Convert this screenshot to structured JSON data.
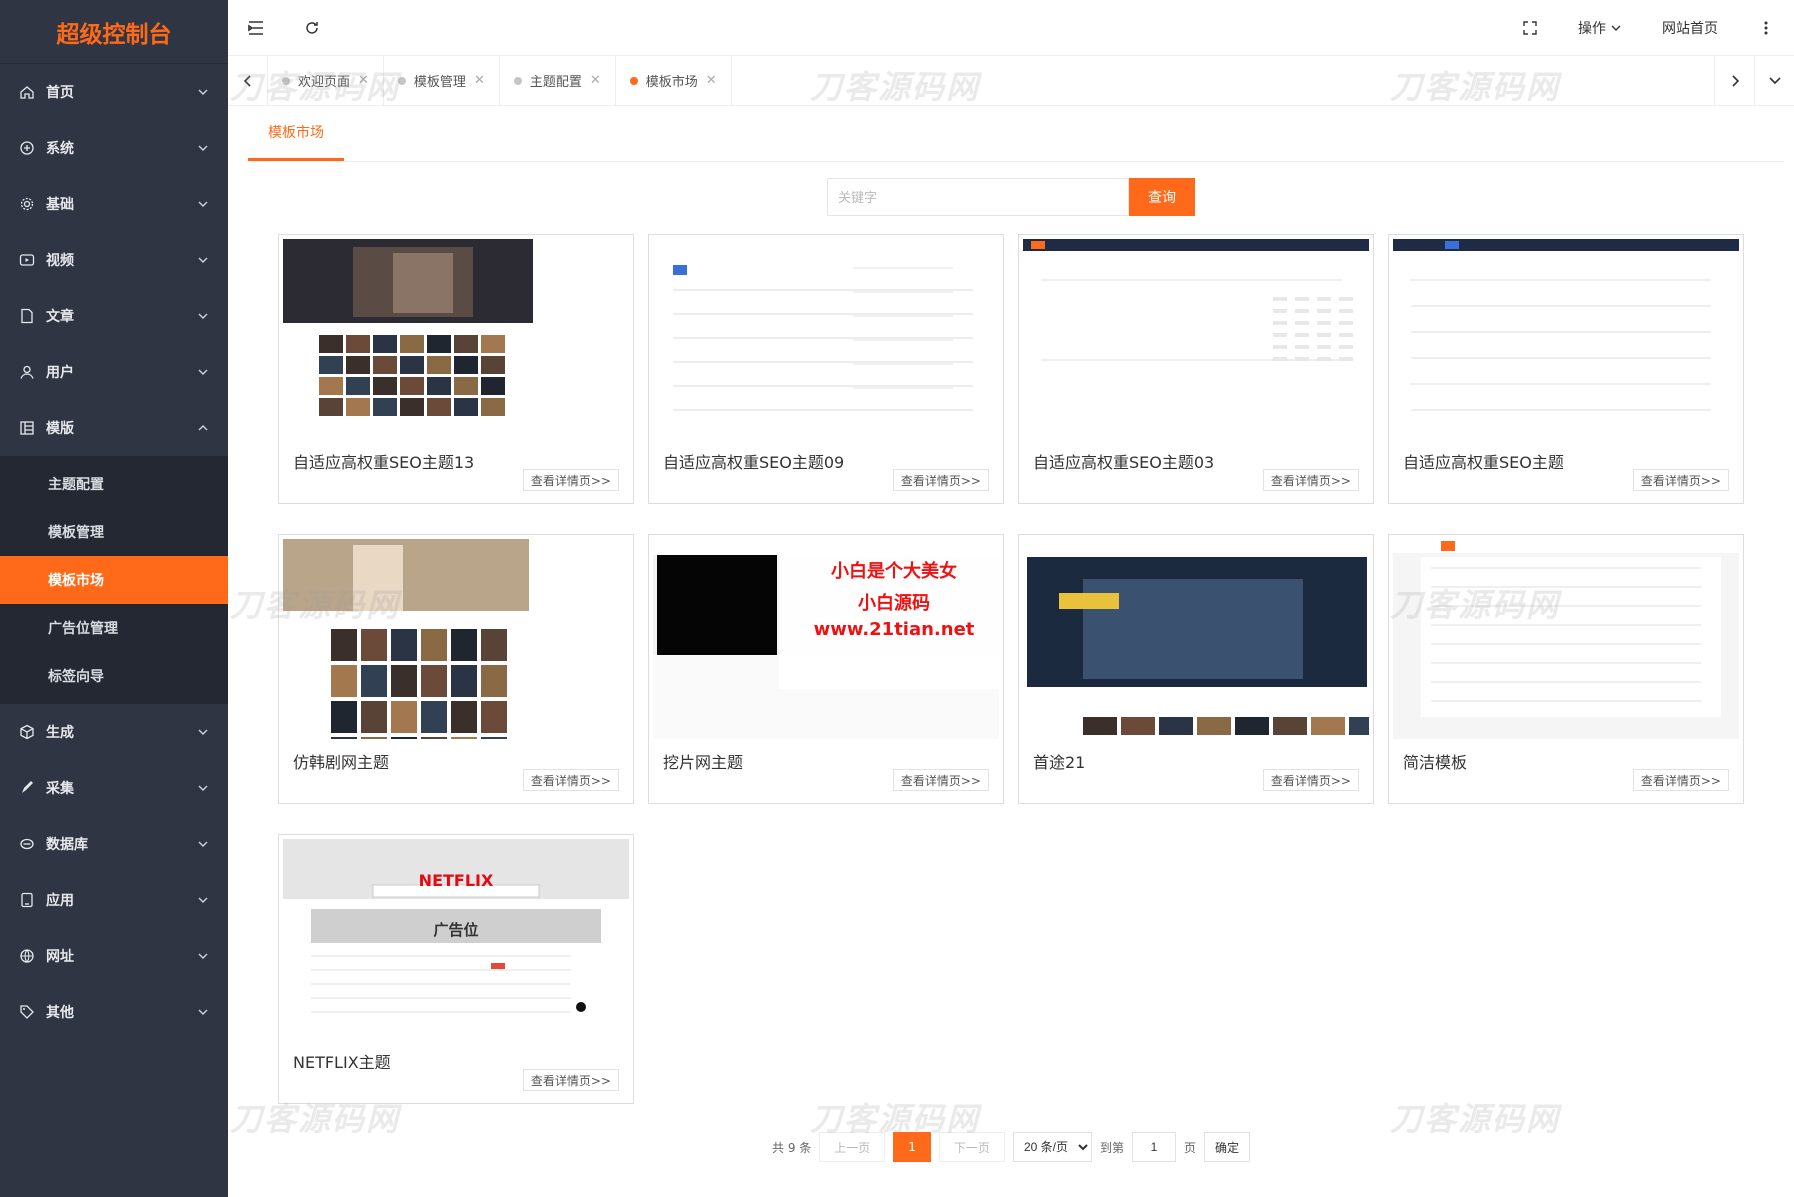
{
  "brand": "超级控制台",
  "sidebar": {
    "items": [
      {
        "label": "首页",
        "icon": "home-icon"
      },
      {
        "label": "系统",
        "icon": "system-icon"
      },
      {
        "label": "基础",
        "icon": "gear-icon"
      },
      {
        "label": "视频",
        "icon": "video-icon"
      },
      {
        "label": "文章",
        "icon": "document-icon"
      },
      {
        "label": "用户",
        "icon": "user-icon"
      },
      {
        "label": "模版",
        "icon": "template-icon"
      },
      {
        "label": "生成",
        "icon": "cube-icon"
      },
      {
        "label": "采集",
        "icon": "pen-icon"
      },
      {
        "label": "数据库",
        "icon": "database-icon"
      },
      {
        "label": "应用",
        "icon": "app-icon"
      },
      {
        "label": "网址",
        "icon": "globe-icon"
      },
      {
        "label": "其他",
        "icon": "tag-icon"
      }
    ],
    "submenu": [
      "主题配置",
      "模板管理",
      "模板市场",
      "广告位管理",
      "标签向导"
    ]
  },
  "topbar": {
    "operate": "操作",
    "site_home": "网站首页"
  },
  "tabs": [
    "欢迎页面",
    "模板管理",
    "主题配置",
    "模板市场"
  ],
  "page_tab": "模板市场",
  "search": {
    "placeholder": "关键字",
    "button": "查询"
  },
  "cards": [
    {
      "title": "自适应高权重SEO主题13",
      "button": "查看详情页>>"
    },
    {
      "title": "自适应高权重SEO主题09",
      "button": "查看详情页>>"
    },
    {
      "title": "自适应高权重SEO主题03",
      "button": "查看详情页>>"
    },
    {
      "title": "自适应高权重SEO主题",
      "button": "查看详情页>>"
    },
    {
      "title": "仿韩剧网主题",
      "button": "查看详情页>>"
    },
    {
      "title": "挖片网主题",
      "button": "查看详情页>>"
    },
    {
      "title": "首途21",
      "button": "查看详情页>>"
    },
    {
      "title": "简洁模板",
      "button": "查看详情页>>"
    },
    {
      "title": "NETFLIX主题",
      "button": "查看详情页>>"
    }
  ],
  "thumbs": {
    "netflix_logo": "NETFLIX",
    "ad_slot": "广告位",
    "promo_big": "小白是个大美女",
    "promo_mid": "小白源码",
    "promo_url": "www.21tian.net"
  },
  "pager": {
    "total": "共 9 条",
    "prev": "上一页",
    "current": "1",
    "next": "下一页",
    "size": "20 条/页",
    "goto": "到第",
    "page_value": "1",
    "page_unit": "页",
    "confirm": "确定"
  },
  "watermark": "刀客源码网",
  "colors": {
    "accent": "#ff6a1a",
    "sidebar_bg": "#2f3542"
  }
}
